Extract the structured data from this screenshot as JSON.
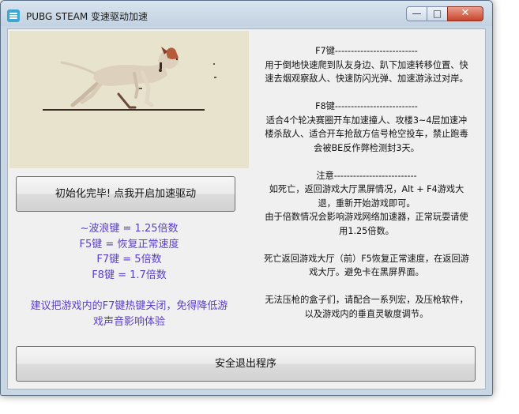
{
  "window": {
    "title": "PUBG STEAM 变速驱动加速",
    "controls": {
      "minimize": "—",
      "maximize": "□",
      "close": "✕"
    }
  },
  "icons": {
    "app": "app-icon",
    "scene": "running-dog-illustration"
  },
  "colors": {
    "accent_text": "#5a3fc8",
    "scene_bg": "#e8e3cd"
  },
  "buttons": {
    "start": "初始化完毕! 点我开启加速驱动",
    "exit": "安全退出程序"
  },
  "keys": [
    "~波浪键 = 1.25倍数",
    "F5键 = 恢复正常速度",
    "F7键 = 5倍数",
    "F8键 = 1.7倍数"
  ],
  "advice": [
    "建议把游戏内的F7键热键关闭，免得降低游",
    "戏声音影响体验"
  ],
  "info": [
    "F7键--------------------------",
    "用于倒地快速爬到队友身边、趴下加速转移位置、快",
    "速去烟观察敌人、快速防闪光弹、加速游泳过对岸。",
    "",
    "F8键--------------------------",
    "适合4个轮决赛圈开车加速撞人、攻楼3~4层加速冲",
    "楼杀敌人、适合开车抢敌方信号枪空投车，禁止跑毒",
    "会被BE反作弊检测封3天。",
    "",
    "注意--------------------------",
    "如死亡，返回游戏大厅黑屏情况，Alt + F4游戏大",
    "退，重新开始游戏即可。",
    "由于倍数情况会影响游戏网络加速器，正常玩耍请使",
    "用1.25倍数。",
    "",
    "死亡返回游戏大厅（前）F5恢复正常速度，在返回游",
    "戏大厅。避免卡在黑屏界面。",
    "",
    "无法压枪的盒子们，请配合一系列宏，及压枪软件，",
    "以及游戏内的垂直灵敏度调节。"
  ]
}
